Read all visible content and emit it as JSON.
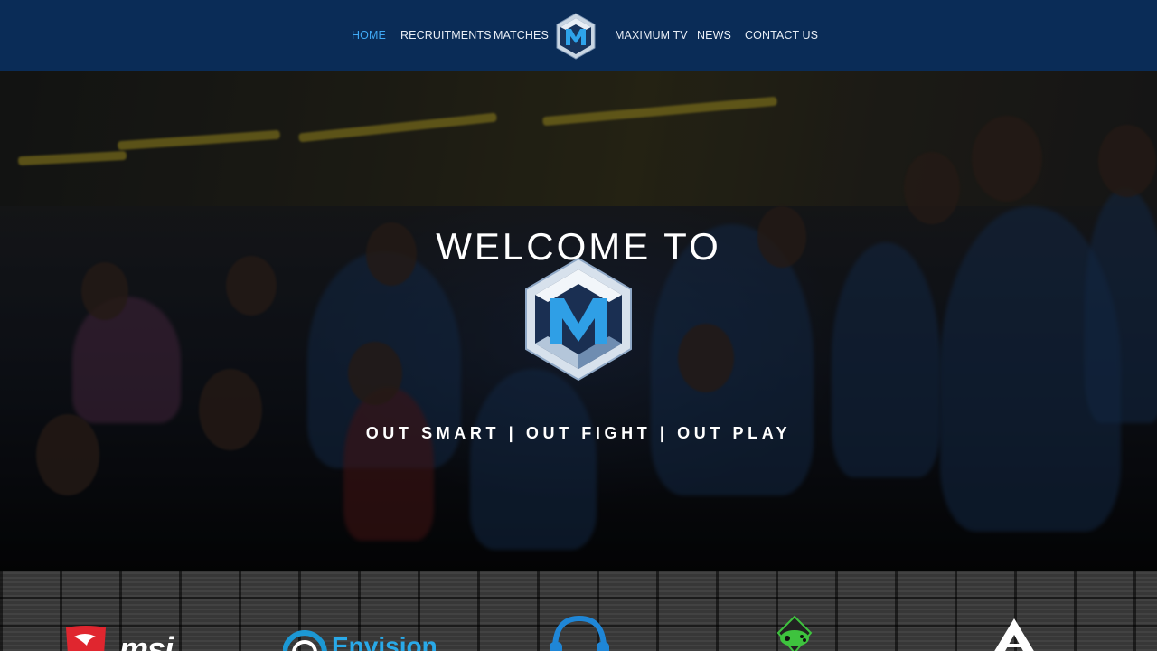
{
  "nav": {
    "items_left": [
      {
        "label": "HOME",
        "active": true
      },
      {
        "label": "RECRUITMENTS"
      },
      {
        "label": "MATCHES"
      }
    ],
    "logo_icon": "maximum-esports-logo",
    "items_right": [
      {
        "label": "MAXIMUM TV"
      },
      {
        "label": "NEWS"
      },
      {
        "label": "CONTACT US"
      }
    ]
  },
  "hero": {
    "heading": "WELCOME TO",
    "logo_icon": "maximum-esports-hex-logo",
    "tagline": "OUT SMART | OUT FIGHT | OUT PLAY"
  },
  "sponsors": [
    {
      "name": "msi",
      "icon": "msi-dragon-icon"
    },
    {
      "name": "Envision",
      "icon": "envision-icon"
    },
    {
      "name": "headset",
      "icon": "headset-icon"
    },
    {
      "name": "gaming",
      "icon": "gaming-controller-icon"
    },
    {
      "name": "triangle",
      "icon": "triangle-logo-icon"
    }
  ],
  "colors": {
    "nav_bg": "#0a2c57",
    "nav_active": "#3fa9f5",
    "brand_blue": "#29a9e8"
  }
}
